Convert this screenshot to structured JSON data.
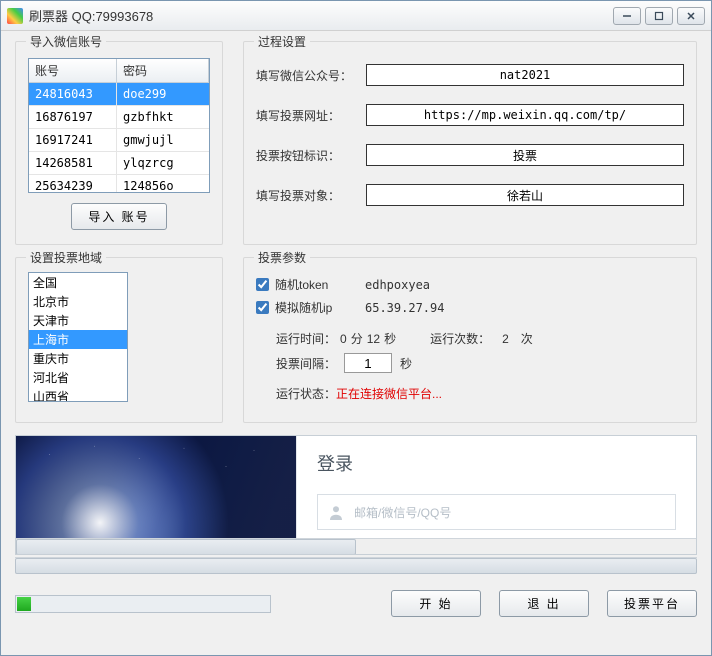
{
  "window": {
    "title": "刷票器  QQ:79993678"
  },
  "accounts": {
    "legend": "导入微信账号",
    "col1": "账号",
    "col2": "密码",
    "rows": [
      {
        "acct": "24816043",
        "pwd": "doe299",
        "sel": true
      },
      {
        "acct": "16876197",
        "pwd": "gzbfhkt"
      },
      {
        "acct": "16917241",
        "pwd": "gmwjujl"
      },
      {
        "acct": "14268581",
        "pwd": "ylqzrcg"
      },
      {
        "acct": "25634239",
        "pwd": "124856o"
      }
    ],
    "import_btn": "导入 账号"
  },
  "process": {
    "legend": "过程设置",
    "f1_label": "填写微信公众号：",
    "f1_value": "nat2021",
    "f2_label": "填写投票网址：",
    "f2_value": "https://mp.weixin.qq.com/tp/",
    "f3_label": "投票按钮标识：",
    "f3_value": "投票",
    "f4_label": "填写投票对象：",
    "f4_value": "徐若山"
  },
  "region": {
    "legend": "设置投票地域",
    "items": [
      {
        "t": "全国"
      },
      {
        "t": "北京市"
      },
      {
        "t": "天津市"
      },
      {
        "t": "上海市",
        "sel": true
      },
      {
        "t": "重庆市"
      },
      {
        "t": "河北省"
      },
      {
        "t": "山西省"
      }
    ]
  },
  "params": {
    "legend": "投票参数",
    "token_label": "随机token",
    "token_value": "edhpoxyea",
    "ip_label": "模拟随机ip",
    "ip_value": "65.39.27.94",
    "runtime_label": "运行时间：",
    "runtime_min": "0",
    "runtime_min_u": "分",
    "runtime_sec": "12",
    "runtime_sec_u": "秒",
    "runcount_label": "运行次数：",
    "runcount_value": "2",
    "runcount_u": "次",
    "interval_label": "投票间隔：",
    "interval_value": "1",
    "interval_unit": "秒",
    "status_label": "运行状态：",
    "status_value": "正在连接微信平台..."
  },
  "login": {
    "title": "登录",
    "placeholder": "邮箱/微信号/QQ号"
  },
  "footer": {
    "start": "开 始",
    "exit": "退 出",
    "platform": "投票平台"
  }
}
